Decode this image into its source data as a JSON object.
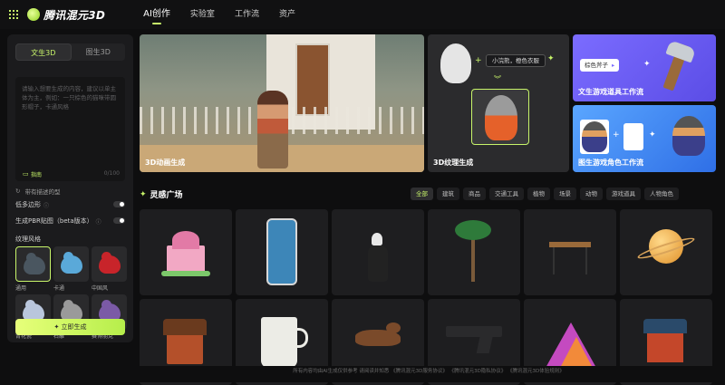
{
  "app": {
    "name": "腾讯混元3D"
  },
  "nav": {
    "items": [
      "AI创作",
      "实验室",
      "工作流",
      "资产"
    ],
    "active": "AI创作"
  },
  "sidebar": {
    "tabs": [
      "文生3D",
      "图生3D"
    ],
    "active_tab": "文生3D",
    "prompt_placeholder": "请输入想要生成的内容，建议以单主体为主，例如：一只棕色的猫咪带圆形帽子，卡通风格",
    "hint_label": "指南",
    "counter": "0/100",
    "ref_label": "带有描述的型",
    "options": [
      {
        "label": "低多边形",
        "toggle": false
      },
      {
        "label": "生成PBR贴图（beta版本）",
        "toggle": false
      }
    ],
    "style_section": "纹理风格",
    "styles": [
      {
        "name": "通用",
        "selected": true,
        "color": "#4a5660"
      },
      {
        "name": "卡通",
        "selected": false,
        "color": "#5aa9d9"
      },
      {
        "name": "中国风",
        "selected": false,
        "color": "#c8242a"
      },
      {
        "name": "青花瓷",
        "selected": false,
        "color": "#b9c6dc"
      },
      {
        "name": "石雕",
        "selected": false,
        "color": "#9a9a9a"
      },
      {
        "name": "赛博朋克",
        "selected": false,
        "color": "#7b5aa6"
      }
    ],
    "generate_label": "立即生成"
  },
  "banners": {
    "animation": {
      "title": "3D动画生成"
    },
    "texture": {
      "title": "3D纹理生成",
      "chip": "小浣熊，橙色衣服"
    },
    "text_prop": {
      "title": "文生游戏道具工作流",
      "chip": "棕色斧子"
    },
    "image_character": {
      "title": "图生游戏角色工作流"
    }
  },
  "inspiration": {
    "title": "灵感广场",
    "categories": [
      "全部",
      "建筑",
      "商品",
      "交通工具",
      "植物",
      "场景",
      "动物",
      "游戏道具",
      "人物角色"
    ],
    "active_category": "全部",
    "cards": [
      {
        "name": "pink-castle"
      },
      {
        "name": "smartphone"
      },
      {
        "name": "sculpture"
      },
      {
        "name": "palm-tree"
      },
      {
        "name": "table"
      },
      {
        "name": "planet"
      },
      {
        "name": "wooden-house"
      },
      {
        "name": "mug"
      },
      {
        "name": "dinosaur"
      },
      {
        "name": "pistol"
      },
      {
        "name": "crystal-mountain"
      },
      {
        "name": "red-cabin"
      }
    ]
  },
  "footer": {
    "text": "所有内容均由AI生成仅供参考 请阅读并知悉 《腾讯混元3D服务协议》 《腾讯混元3D隐私协议》 《腾讯混元3D体验规则》"
  },
  "colors": {
    "accent": "#c8f56a",
    "bg": "#0e0e0f",
    "panel": "#1b1b1d"
  }
}
